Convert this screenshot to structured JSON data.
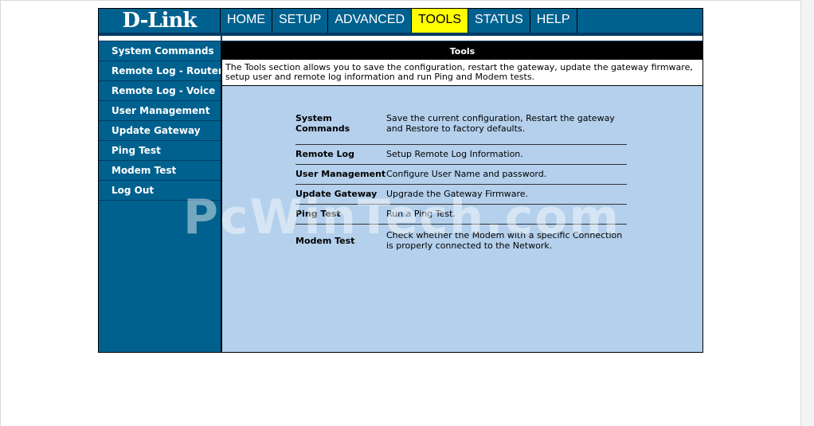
{
  "brand": {
    "logo_text": "D-Link"
  },
  "nav": {
    "tabs": [
      {
        "label": "HOME",
        "active": false
      },
      {
        "label": "SETUP",
        "active": false
      },
      {
        "label": "ADVANCED",
        "active": false
      },
      {
        "label": "TOOLS",
        "active": true
      },
      {
        "label": "STATUS",
        "active": false
      },
      {
        "label": "HELP",
        "active": false
      }
    ]
  },
  "sidebar": {
    "items": [
      {
        "label": "System Commands"
      },
      {
        "label": "Remote Log - Router"
      },
      {
        "label": "Remote Log - Voice"
      },
      {
        "label": "User Management"
      },
      {
        "label": "Update Gateway"
      },
      {
        "label": "Ping Test"
      },
      {
        "label": "Modem Test"
      },
      {
        "label": "Log Out"
      }
    ]
  },
  "content": {
    "title": "Tools",
    "intro": "The Tools section allows you to save the configuration, restart the gateway, update the gateway firmware, setup user and remote log information and run Ping and Modem tests.",
    "rows": [
      {
        "name": "System Commands",
        "desc": "Save the current configuration, Restart the gateway and Restore to factory defaults."
      },
      {
        "name": "Remote Log",
        "desc": "Setup Remote Log Information."
      },
      {
        "name": "User Management",
        "desc": "Configure User Name and password."
      },
      {
        "name": "Update Gateway",
        "desc": "Upgrade the Gateway Firmware."
      },
      {
        "name": "Ping Test",
        "desc": "Run a Ping Test."
      },
      {
        "name": "Modem Test",
        "desc": "Check whether the Modem with a specific Connection is properly connected to the Network."
      }
    ]
  },
  "watermark": "PcWinTech.com",
  "colors": {
    "brand_blue": "#00618f",
    "active_tab": "#ffff00",
    "content_bg": "#b4d0ec"
  }
}
